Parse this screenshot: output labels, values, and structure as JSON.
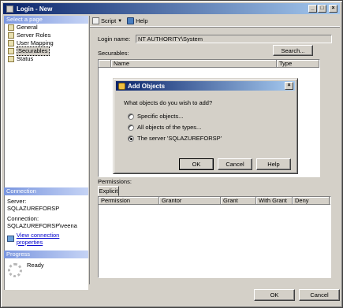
{
  "window": {
    "title": "Login - New",
    "buttons": {
      "minimize": "_",
      "maximize": "□",
      "close": "×"
    }
  },
  "left": {
    "select_page_header": "Select a page",
    "pages": [
      {
        "label": "General",
        "selected": false
      },
      {
        "label": "Server Roles",
        "selected": false
      },
      {
        "label": "User Mapping",
        "selected": false
      },
      {
        "label": "Securables",
        "selected": true
      },
      {
        "label": "Status",
        "selected": false
      }
    ],
    "connection_header": "Connection",
    "server_label": "Server:",
    "server_value": "SQLAZUREFORSP",
    "connection_label": "Connection:",
    "connection_value": "SQLAZUREFORSP\\veena",
    "view_props_link": "View connection properties",
    "progress_header": "Progress",
    "progress_status": "Ready"
  },
  "toolbar": {
    "script_label": "Script",
    "help_label": "Help"
  },
  "main": {
    "login_name_label": "Login name:",
    "login_name_value": "NT AUTHORITY\\System",
    "securables_label": "Securables:",
    "search_button": "Search...",
    "securables_columns": [
      "",
      "Name",
      "Type"
    ],
    "permissions_label": "Permissions:",
    "explicit_tab": "Explicit",
    "permissions_columns": [
      "Permission",
      "Grantor",
      "Grant",
      "With Grant",
      "Deny"
    ]
  },
  "footer": {
    "ok_label": "OK",
    "cancel_label": "Cancel"
  },
  "dialog": {
    "title": "Add Objects",
    "close": "×",
    "question": "What objects do you wish to add?",
    "options": [
      {
        "label": "Specific objects...",
        "checked": false
      },
      {
        "label": "All objects of the types...",
        "checked": false
      },
      {
        "label": "The server 'SQLAZUREFORSP'",
        "checked": true
      }
    ],
    "ok_label": "OK",
    "cancel_label": "Cancel",
    "help_label": "Help"
  }
}
